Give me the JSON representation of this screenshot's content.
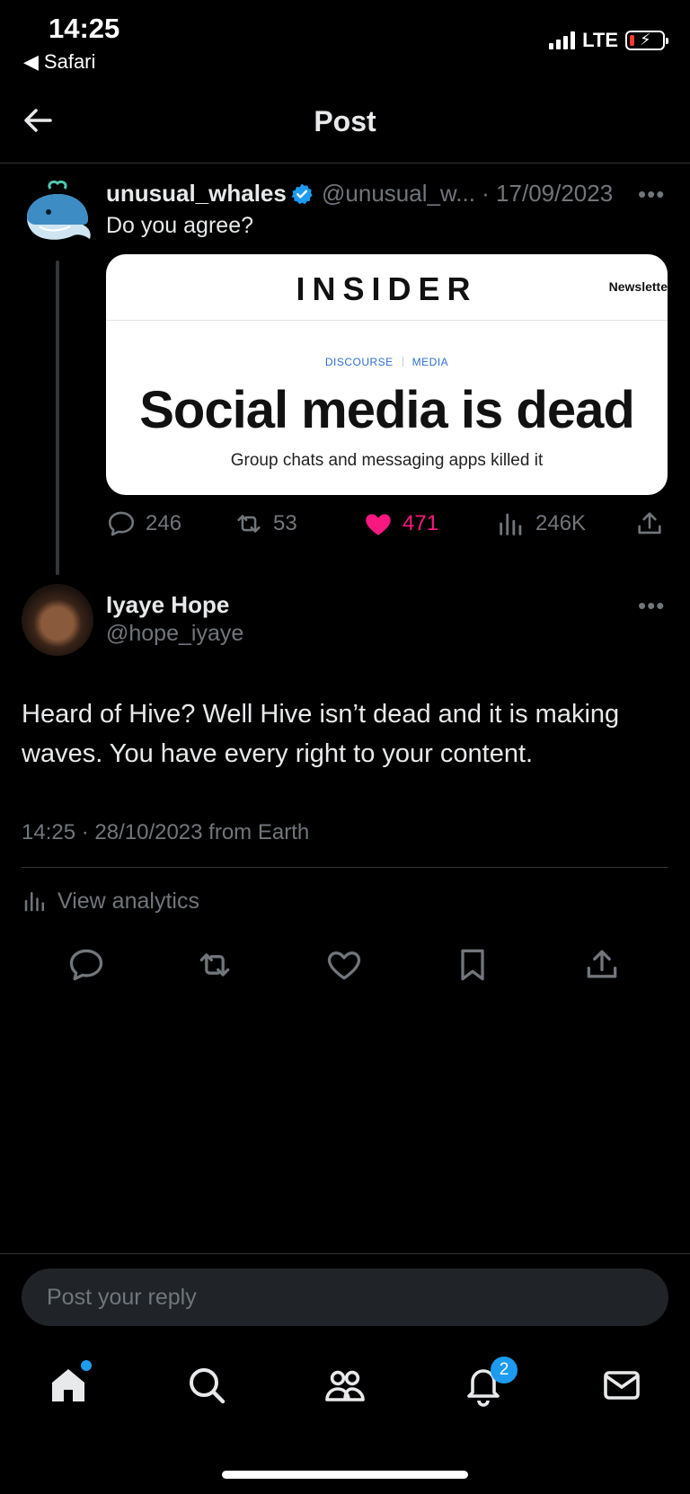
{
  "status_bar": {
    "time": "14:25",
    "back_app": "Safari",
    "network": "LTE"
  },
  "header": {
    "title": "Post"
  },
  "quoted_post": {
    "name": "unusual_whales",
    "handle_date": "@unusual_w... · 17/09/2023",
    "text": "Do you agree?",
    "card": {
      "brand": "INSIDER",
      "nav_link": "Newslette",
      "tags": [
        "DISCOURSE",
        "MEDIA"
      ],
      "headline": "Social media is dead",
      "subheadline": "Group chats and messaging apps killed it"
    },
    "actions": {
      "replies": "246",
      "reposts": "53",
      "likes": "471",
      "views": "246K"
    }
  },
  "post": {
    "name": "Iyaye Hope",
    "handle": "@hope_iyaye",
    "text": "Heard of Hive? Well Hive isn’t dead and it is making waves. You have every right to your content.",
    "meta": "14:25 · 28/10/2023 from Earth",
    "analytics_label": "View analytics"
  },
  "reply": {
    "placeholder": "Post your reply"
  },
  "nav": {
    "notifications_badge": "2"
  },
  "colors": {
    "accent": "#1d9bf0",
    "like": "#f91880",
    "muted": "#71767b"
  }
}
